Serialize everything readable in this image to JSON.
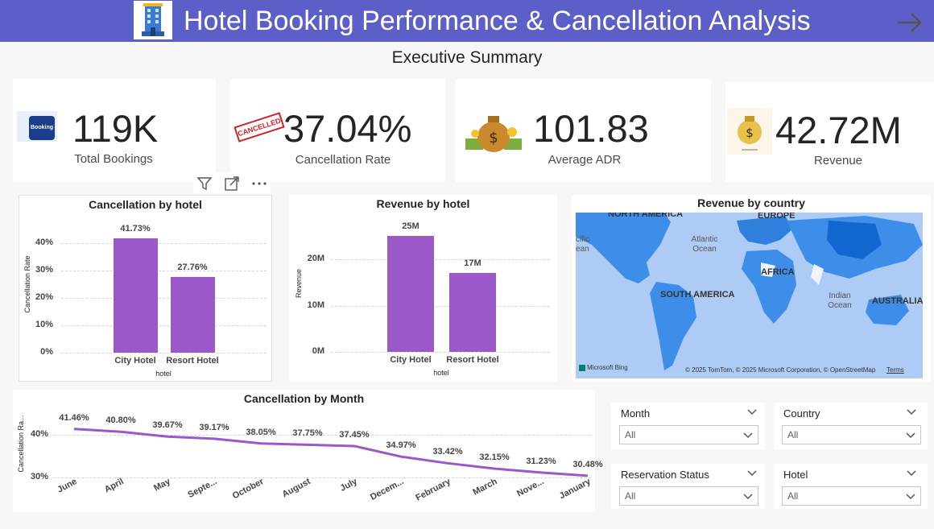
{
  "header": {
    "title": "Hotel Booking Performance & Cancellation Analysis",
    "icon": "hotel-building-icon",
    "nav_icon": "arrow-right-icon"
  },
  "page": {
    "subtitle": "Executive Summary"
  },
  "kpis": [
    {
      "value": "119K",
      "label": "Total Bookings",
      "icon": "booking-logo-icon",
      "icon_text": "Booking"
    },
    {
      "value": "37.04%",
      "label": "Cancellation Rate",
      "icon": "cancelled-stamp-icon",
      "icon_text": "CANCELLED"
    },
    {
      "value": "101.83",
      "label": "Average ADR",
      "icon": "money-bag-icon"
    },
    {
      "value": "42.72M",
      "label": "Revenue",
      "icon": "revenue-bag-icon"
    }
  ],
  "toolbar": {
    "filter_icon": "filter-icon",
    "focus_icon": "focus-mode-icon",
    "more_icon": "more-options-icon"
  },
  "colors": {
    "header_bg": "#5b5fc7",
    "bar": "#9b58c9",
    "line": "#9b58c9",
    "map_water": "#aecbf5"
  },
  "cancellation_by_hotel": {
    "title": "Cancellation by hotel",
    "xlabel": "hotel",
    "ylabel": "Cancellation Rate",
    "yticks": [
      "0%",
      "10%",
      "20%",
      "30%",
      "40%"
    ]
  },
  "revenue_by_hotel": {
    "title": "Revenue by hotel",
    "xlabel": "hotel",
    "ylabel": "Revenue",
    "yticks": [
      "0M",
      "10M",
      "20M"
    ]
  },
  "revenue_by_country": {
    "title": "Revenue by country",
    "labels": [
      "NORTH AMERICA",
      "EUROPE",
      "Atlantic Ocean",
      "AFRICA",
      "SOUTH AMERICA",
      "Indian Ocean",
      "AUSTRALIA",
      "cific ean"
    ],
    "bing": "Microsoft Bing",
    "credit": "© 2025 TomTom, © 2025 Microsoft Corporation, © OpenStreetMap",
    "terms": "Terms"
  },
  "cancellation_by_month": {
    "title": "Cancellation by Month",
    "ylabel": "Cancellation Ra...",
    "yticks": [
      "30%",
      "40%"
    ]
  },
  "slicers": [
    {
      "title": "Month",
      "value": "All"
    },
    {
      "title": "Country",
      "value": "All"
    },
    {
      "title": "Reservation Status",
      "value": "All"
    },
    {
      "title": "Hotel",
      "value": "All"
    }
  ],
  "chart_data": [
    {
      "type": "bar",
      "title": "Cancellation by hotel",
      "categories": [
        "City Hotel",
        "Resort Hotel"
      ],
      "values": [
        41.73,
        27.76
      ],
      "data_labels": [
        "41.73%",
        "27.76%"
      ],
      "xlabel": "hotel",
      "ylabel": "Cancellation Rate",
      "ylim": [
        0,
        45
      ],
      "grid": true
    },
    {
      "type": "bar",
      "title": "Revenue by hotel",
      "categories": [
        "City Hotel",
        "Resort Hotel"
      ],
      "values": [
        25,
        17
      ],
      "data_labels": [
        "25M",
        "17M"
      ],
      "xlabel": "hotel",
      "ylabel": "Revenue",
      "ylim": [
        0,
        27
      ],
      "grid": true
    },
    {
      "type": "line",
      "title": "Cancellation by Month",
      "categories": [
        "June",
        "April",
        "May",
        "Septe...",
        "October",
        "August",
        "July",
        "Decem...",
        "February",
        "March",
        "Nove...",
        "January"
      ],
      "values": [
        41.46,
        40.8,
        39.67,
        39.17,
        38.05,
        37.75,
        37.45,
        34.97,
        33.42,
        32.15,
        31.23,
        30.48
      ],
      "data_labels": [
        "41.46%",
        "40.80%",
        "39.67%",
        "39.17%",
        "38.05%",
        "37.75%",
        "37.45%",
        "34.97%",
        "33.42%",
        "32.15%",
        "31.23%",
        "30.48%"
      ],
      "ylabel": "Cancellation Ra...",
      "ylim": [
        28,
        45
      ],
      "grid": true
    }
  ]
}
